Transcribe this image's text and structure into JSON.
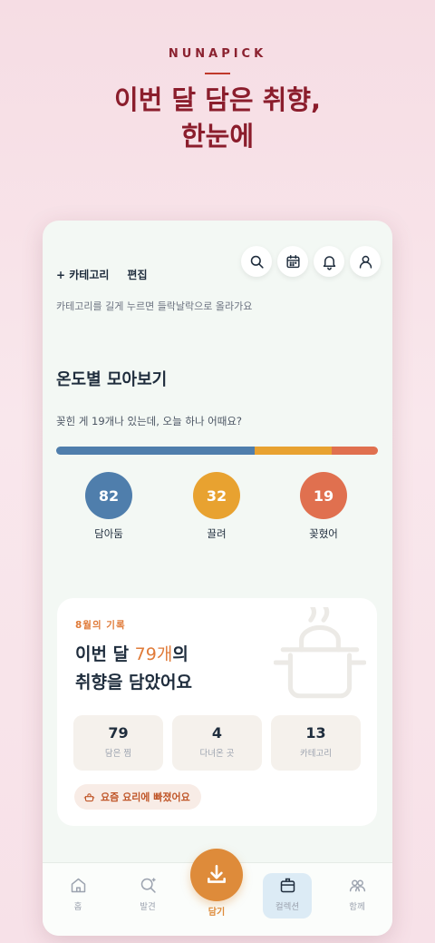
{
  "brand": "NUNAPICK",
  "headline": [
    "이번 달 담은 취향,",
    "한눈에"
  ],
  "header": {
    "add_category": "+ 카테고리",
    "edit": "편집",
    "hint": "카테고리를 길게 누르면 들락날락으로 올라가요",
    "icons": [
      "search-icon",
      "calendar-icon",
      "bell-icon",
      "user-icon"
    ]
  },
  "temperature": {
    "title": "온도별 모아보기",
    "subtitle": "꽂힌 게 19개나 있는데, 오늘 하나 어때요?",
    "stats": [
      {
        "value": "82",
        "label": "담아둠",
        "color": "#4f7eac"
      },
      {
        "value": "32",
        "label": "끌려",
        "color": "#e8a230"
      },
      {
        "value": "19",
        "label": "꽂혔어",
        "color": "#e0704f"
      }
    ]
  },
  "monthly": {
    "eyebrow": "8월의 기록",
    "title_prefix": "이번 달 ",
    "title_num": "79개",
    "title_suffix": "의",
    "title_line2": "취향을 담았어요",
    "mini_stats": [
      {
        "value": "79",
        "label": "담은 찜"
      },
      {
        "value": "4",
        "label": "다녀온 곳"
      },
      {
        "value": "13",
        "label": "카테고리"
      }
    ],
    "pill": "요즘 요리에 빠졌어요"
  },
  "nav": {
    "items": [
      {
        "label": "홈",
        "icon": "home-icon"
      },
      {
        "label": "발견",
        "icon": "discover-icon"
      },
      {
        "label": "담기",
        "icon": "download-icon"
      },
      {
        "label": "컬렉션",
        "icon": "collection-icon"
      },
      {
        "label": "함께",
        "icon": "people-icon"
      }
    ],
    "active": "컬렉션"
  },
  "colors": {
    "accent": "#de8b3a",
    "brand": "#8b1d2c",
    "blue": "#4f7eac",
    "yellow": "#e8a230",
    "red": "#e0704f"
  }
}
